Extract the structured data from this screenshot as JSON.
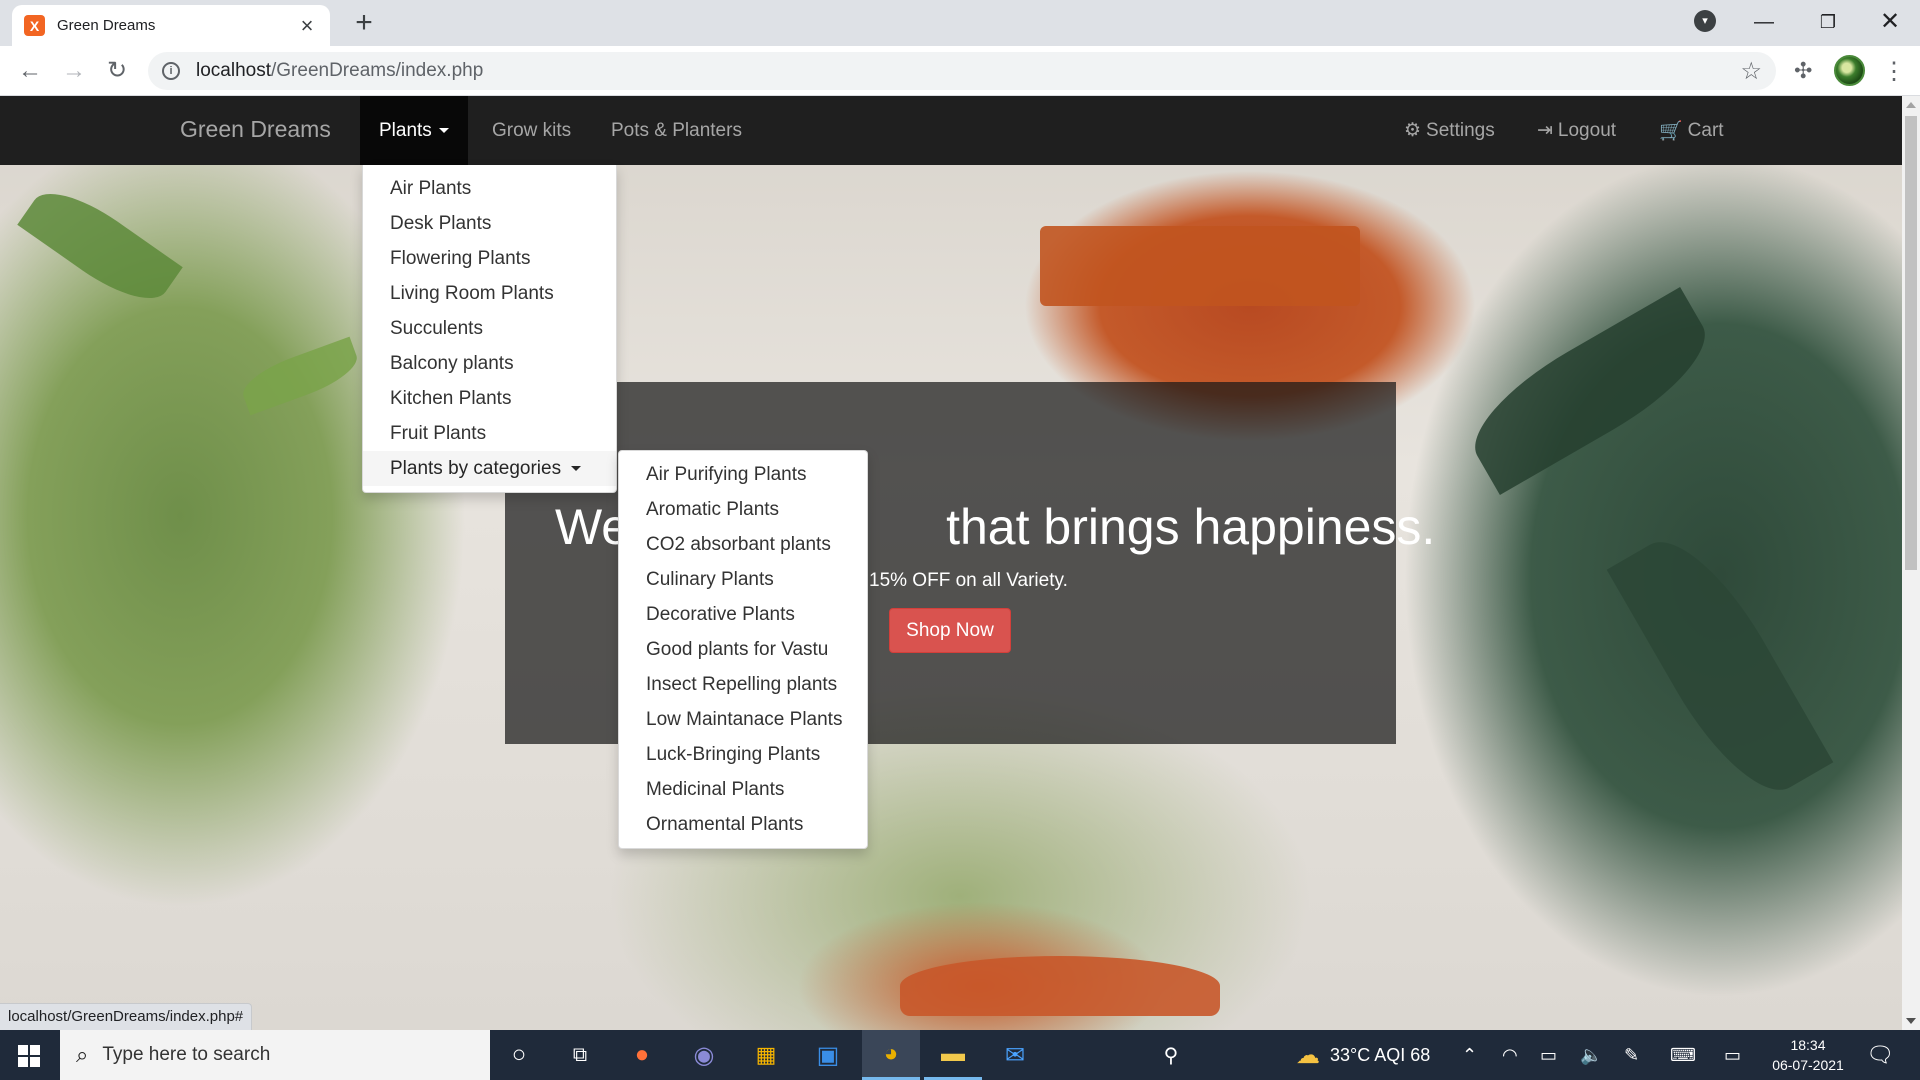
{
  "browser": {
    "tab_title": "Green Dreams",
    "tab_favicon": "X",
    "url_host": "localhost",
    "url_path": "/GreenDreams/index.php",
    "status_url": "localhost/GreenDreams/index.php#"
  },
  "navbar": {
    "brand": "Green Dreams",
    "items": [
      "Plants",
      "Grow kits",
      "Pots & Planters"
    ],
    "right_items": [
      "Settings",
      "Logout",
      "Cart"
    ]
  },
  "plants_menu": [
    "Air Plants",
    "Desk Plants",
    "Flowering Plants",
    "Living Room Plants",
    "Succulents",
    "Balcony plants",
    "Kitchen Plants",
    "Fruit Plants",
    "Plants by categories"
  ],
  "categories_menu": [
    "Air Purifying Plants",
    "Aromatic Plants",
    "CO2 absorbant plants",
    "Culinary Plants",
    "Decorative Plants",
    "Good plants for Vastu",
    "Insect Repelling plants",
    "Low Maintanace Plants",
    "Luck-Bringing Plants",
    "Medicinal Plants",
    "Ornamental Plants"
  ],
  "hero": {
    "headline_start": "We",
    "headline_end": "that brings happiness.",
    "subline": "15% OFF on all Variety.",
    "cta": "Shop Now"
  },
  "taskbar": {
    "search_placeholder": "Type here to search",
    "weather": "33°C  AQI 68",
    "time": "18:34",
    "date": "06-07-2021"
  },
  "colors": {
    "navbar_bg": "#1f1f1f",
    "cta_bg": "#d9534f"
  }
}
